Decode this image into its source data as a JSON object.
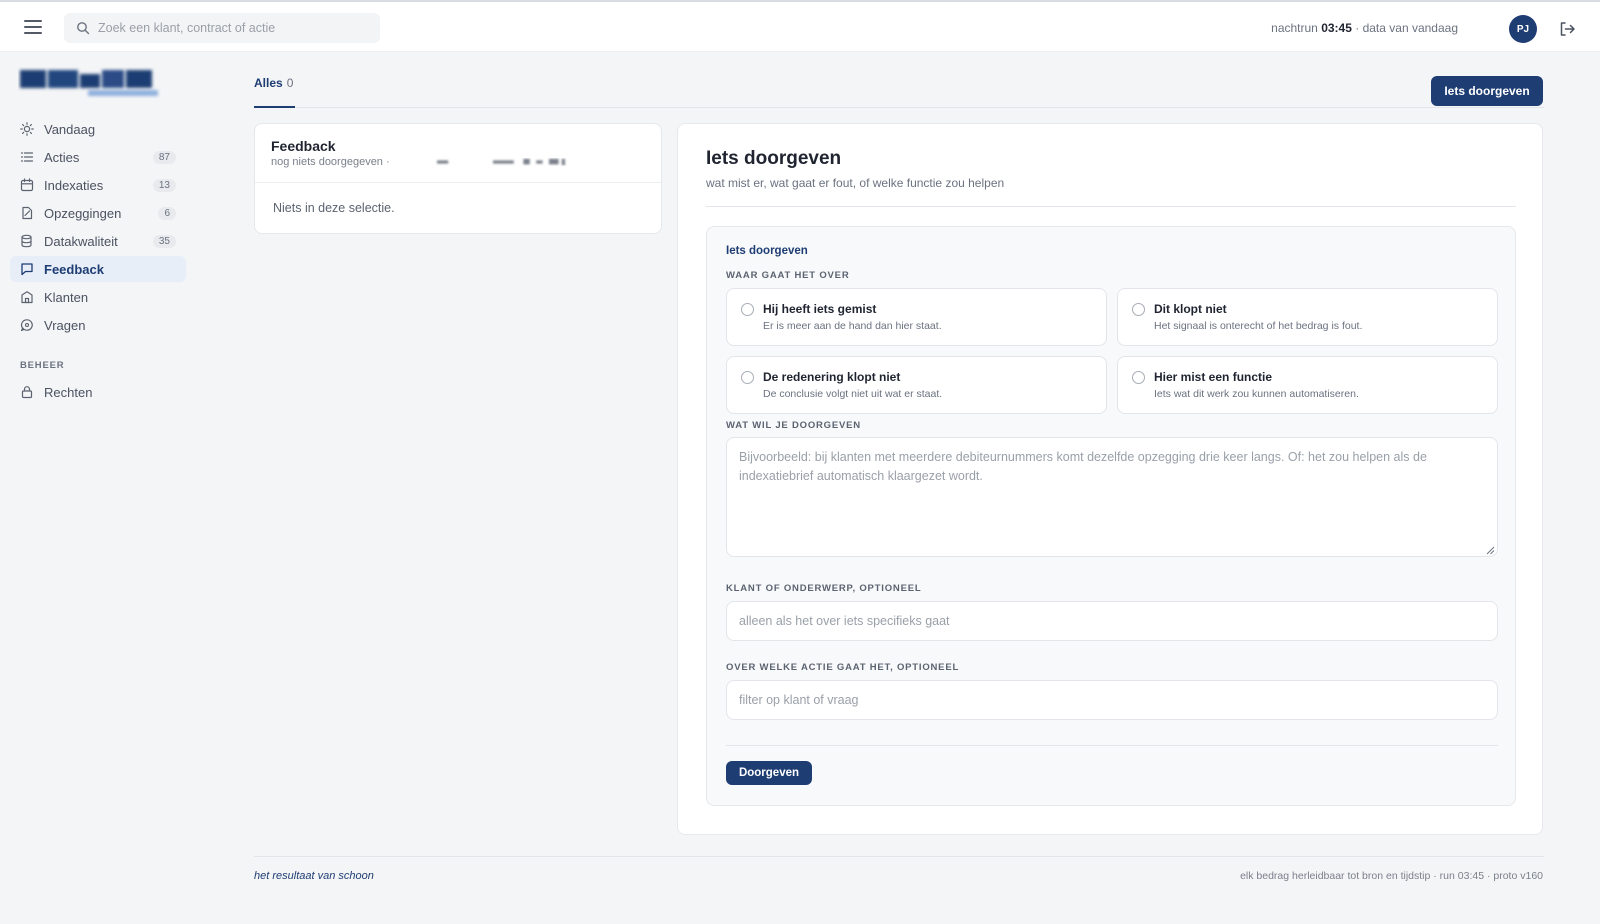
{
  "topbar": {
    "search_placeholder": "Zoek een klant, contract of actie",
    "run_prefix": "nachtrun",
    "run_time": "03:45",
    "run_suffix": "· data van vandaag",
    "avatar_initials": "PJ"
  },
  "sidebar": {
    "items": [
      {
        "label": "Vandaag",
        "count": "",
        "icon": "sun-icon"
      },
      {
        "label": "Acties",
        "count": "87",
        "icon": "list-icon"
      },
      {
        "label": "Indexaties",
        "count": "13",
        "icon": "calendar-icon"
      },
      {
        "label": "Opzeggingen",
        "count": "6",
        "icon": "document-icon"
      },
      {
        "label": "Datakwaliteit",
        "count": "35",
        "icon": "database-icon"
      },
      {
        "label": "Feedback",
        "count": "",
        "icon": "chat-icon",
        "active": true
      },
      {
        "label": "Klanten",
        "count": "",
        "icon": "building-icon"
      },
      {
        "label": "Vragen",
        "count": "",
        "icon": "question-chat-icon"
      }
    ],
    "section_beheer": "BEHEER",
    "beheer_items": [
      {
        "label": "Rechten",
        "icon": "lock-icon"
      }
    ]
  },
  "tabs": {
    "all_label": "Alles",
    "all_count": "0"
  },
  "header_button": "Iets doorgeven",
  "feedback_list": {
    "title": "Feedback",
    "subtitle": "nog niets doorgegeven ·",
    "empty": "Niets in deze selectie."
  },
  "form": {
    "title": "Iets doorgeven",
    "subtitle": "wat mist er, wat gaat er fout, of welke functie zou helpen",
    "inner_title": "Iets doorgeven",
    "label_topic": "WAAR GAAT HET OVER",
    "options": [
      {
        "title": "Hij heeft iets gemist",
        "desc": "Er is meer aan de hand dan hier staat."
      },
      {
        "title": "Dit klopt niet",
        "desc": "Het signaal is onterecht of het bedrag is fout."
      },
      {
        "title": "De redenering klopt niet",
        "desc": "De conclusie volgt niet uit wat er staat."
      },
      {
        "title": "Hier mist een functie",
        "desc": "Iets wat dit werk zou kunnen automatiseren."
      }
    ],
    "label_message": "WAT WIL JE DOORGEVEN",
    "message_placeholder": "Bijvoorbeeld: bij klanten met meerdere debiteurnummers komt dezelfde opzegging drie keer langs. Of: het zou helpen als de indexatiebrief automatisch klaargezet wordt.",
    "label_client": "KLANT OF ONDERWERP, OPTIONEEL",
    "client_placeholder": "alleen als het over iets specifieks gaat",
    "label_action": "OVER WELKE ACTIE GAAT HET, OPTIONEEL",
    "action_placeholder": "filter op klant of vraag",
    "submit": "Doorgeven"
  },
  "footer": {
    "left": "het resultaat van schoon",
    "right": "elk bedrag herleidbaar tot bron en tijdstip · run 03:45 · proto v160"
  },
  "colors": {
    "brand": "#1e3d73",
    "background": "#f4f5f7",
    "active_nav_bg": "#e8eef8"
  }
}
